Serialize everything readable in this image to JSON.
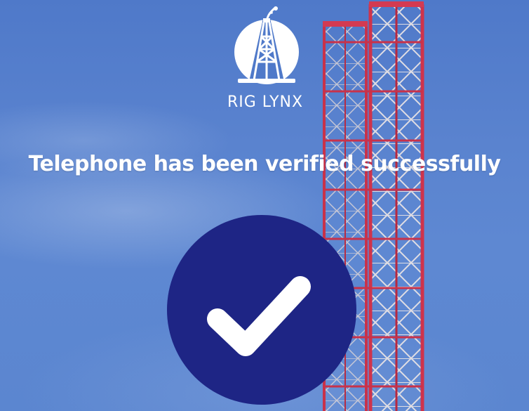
{
  "logo": {
    "brand_name": "RIG LYNX",
    "icon": "oil-rig-icon"
  },
  "verification": {
    "message": "Telephone has been verified successfully",
    "status_icon": "checkmark-icon"
  },
  "colors": {
    "sky": "#5a83cf",
    "badge": "#1e2585",
    "tower_red": "#c8324a",
    "text": "#ffffff"
  }
}
